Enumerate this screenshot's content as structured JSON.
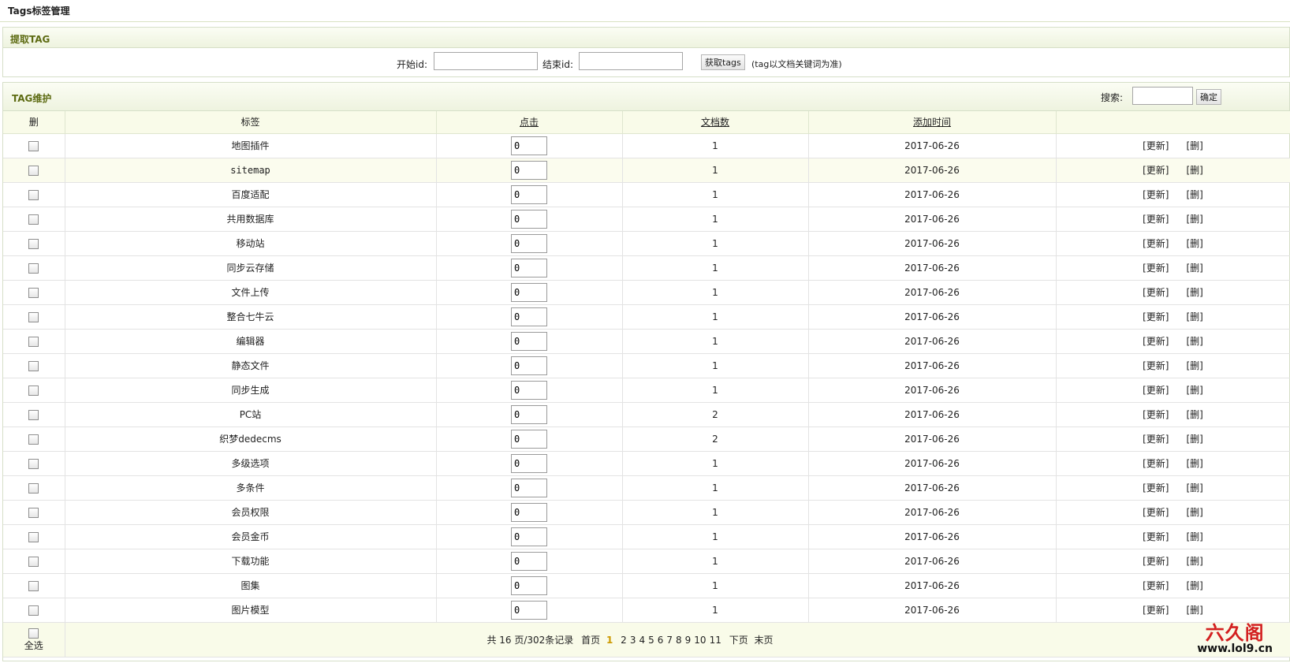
{
  "page": {
    "title": "Tags标签管理"
  },
  "extract": {
    "title": "提取TAG",
    "start_label": "开始id:",
    "start_value": "",
    "end_label": "结束id:",
    "end_value": "",
    "fetch_button": "获取tags",
    "hint": "(tag以文档关键词为准)"
  },
  "maintain": {
    "title": "TAG维护",
    "search_label": "搜索:",
    "search_value": "",
    "confirm_button": "确定"
  },
  "table": {
    "headers": {
      "del": "删",
      "tag": "标签",
      "clicks": "点击",
      "docs": "文档数",
      "added": "添加时间",
      "ops": ""
    },
    "rows": [
      {
        "tag": "地图插件",
        "clicks": "0",
        "docs": "1",
        "added": "2017-06-26",
        "update": "[更新]",
        "delete": "[删]"
      },
      {
        "tag": "sitemap",
        "clicks": "0",
        "docs": "1",
        "added": "2017-06-26",
        "update": "[更新]",
        "delete": "[删]"
      },
      {
        "tag": "百度适配",
        "clicks": "0",
        "docs": "1",
        "added": "2017-06-26",
        "update": "[更新]",
        "delete": "[删]"
      },
      {
        "tag": "共用数据库",
        "clicks": "0",
        "docs": "1",
        "added": "2017-06-26",
        "update": "[更新]",
        "delete": "[删]"
      },
      {
        "tag": "移动站",
        "clicks": "0",
        "docs": "1",
        "added": "2017-06-26",
        "update": "[更新]",
        "delete": "[删]"
      },
      {
        "tag": "同步云存储",
        "clicks": "0",
        "docs": "1",
        "added": "2017-06-26",
        "update": "[更新]",
        "delete": "[删]"
      },
      {
        "tag": "文件上传",
        "clicks": "0",
        "docs": "1",
        "added": "2017-06-26",
        "update": "[更新]",
        "delete": "[删]"
      },
      {
        "tag": "整合七牛云",
        "clicks": "0",
        "docs": "1",
        "added": "2017-06-26",
        "update": "[更新]",
        "delete": "[删]"
      },
      {
        "tag": "编辑器",
        "clicks": "0",
        "docs": "1",
        "added": "2017-06-26",
        "update": "[更新]",
        "delete": "[删]"
      },
      {
        "tag": "静态文件",
        "clicks": "0",
        "docs": "1",
        "added": "2017-06-26",
        "update": "[更新]",
        "delete": "[删]"
      },
      {
        "tag": "同步生成",
        "clicks": "0",
        "docs": "1",
        "added": "2017-06-26",
        "update": "[更新]",
        "delete": "[删]"
      },
      {
        "tag": "PC站",
        "clicks": "0",
        "docs": "2",
        "added": "2017-06-26",
        "update": "[更新]",
        "delete": "[删]"
      },
      {
        "tag": "织梦dedecms",
        "clicks": "0",
        "docs": "2",
        "added": "2017-06-26",
        "update": "[更新]",
        "delete": "[删]"
      },
      {
        "tag": "多级选项",
        "clicks": "0",
        "docs": "1",
        "added": "2017-06-26",
        "update": "[更新]",
        "delete": "[删]"
      },
      {
        "tag": "多条件",
        "clicks": "0",
        "docs": "1",
        "added": "2017-06-26",
        "update": "[更新]",
        "delete": "[删]"
      },
      {
        "tag": "会员权限",
        "clicks": "0",
        "docs": "1",
        "added": "2017-06-26",
        "update": "[更新]",
        "delete": "[删]"
      },
      {
        "tag": "会员金币",
        "clicks": "0",
        "docs": "1",
        "added": "2017-06-26",
        "update": "[更新]",
        "delete": "[删]"
      },
      {
        "tag": "下载功能",
        "clicks": "0",
        "docs": "1",
        "added": "2017-06-26",
        "update": "[更新]",
        "delete": "[删]"
      },
      {
        "tag": "图集",
        "clicks": "0",
        "docs": "1",
        "added": "2017-06-26",
        "update": "[更新]",
        "delete": "[删]"
      },
      {
        "tag": "图片模型",
        "clicks": "0",
        "docs": "1",
        "added": "2017-06-26",
        "update": "[更新]",
        "delete": "[删]"
      }
    ],
    "select_all": "全选"
  },
  "pager": {
    "info": "共 16 页/302条记录",
    "first": "首页",
    "current": "1",
    "pages": [
      "2",
      "3",
      "4",
      "5",
      "6",
      "7",
      "8",
      "9",
      "10",
      "11"
    ],
    "next": "下页",
    "last": "末页"
  },
  "watermark": {
    "brand": "六久阁",
    "url": "www.lol9.cn"
  }
}
